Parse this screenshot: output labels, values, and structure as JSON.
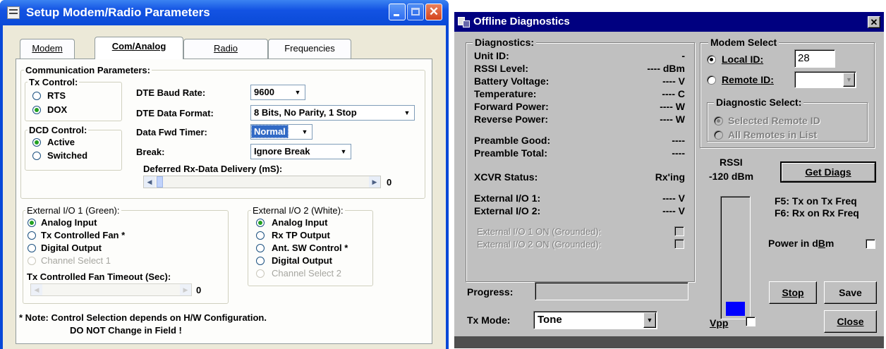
{
  "setup_window": {
    "title": "Setup Modem/Radio Parameters",
    "tabs": [
      "Modem",
      "Com/Analog",
      "Radio",
      "Frequencies"
    ],
    "comm_group": "Communication Parameters:",
    "tx_control": {
      "label": "Tx Control:",
      "options": [
        "RTS",
        "DOX"
      ],
      "selected": "DOX"
    },
    "dcd_control": {
      "label": "DCD Control:",
      "options": [
        "Active",
        "Switched"
      ],
      "selected": "Active"
    },
    "fields": {
      "baud_label": "DTE Baud Rate:",
      "baud_value": "9600",
      "format_label": "DTE Data Format:",
      "format_value": "8 Bits, No Parity, 1 Stop",
      "timer_label": "Data Fwd Timer:",
      "timer_value": "Normal",
      "break_label": "Break:",
      "break_value": "Ignore Break",
      "deferred_label": "Deferred Rx-Data Delivery (mS):",
      "deferred_value": "0"
    },
    "ext_io_1": {
      "label": "External I/O 1 (Green):",
      "options": [
        "Analog Input",
        "Tx Controlled Fan *",
        "Digital Output",
        "Channel Select 1"
      ],
      "selected": "Analog Input",
      "fan_timeout_label": "Tx Controlled Fan Timeout (Sec):",
      "fan_timeout_value": "0"
    },
    "ext_io_2": {
      "label": "External I/O 2 (White):",
      "options": [
        "Analog Input",
        "Rx TP Output",
        "Ant. SW Control *",
        "Digital Output",
        "Channel Select 2"
      ],
      "selected": "Analog Input"
    },
    "note_line1": "* Note:  Control Selection depends on H/W Configuration.",
    "note_line2": "DO NOT Change in Field !"
  },
  "diag_window": {
    "title": "Offline Diagnostics",
    "diag_group": "Diagnostics:",
    "rows": [
      {
        "label": "Unit ID:",
        "value": "-"
      },
      {
        "label": "RSSI Level:",
        "value": "---- dBm"
      },
      {
        "label": "Battery Voltage:",
        "value": "---- V"
      },
      {
        "label": "Temperature:",
        "value": "---- C"
      },
      {
        "label": "Forward Power:",
        "value": "---- W"
      },
      {
        "label": "Reverse Power:",
        "value": "---- W"
      },
      {
        "label": "Preamble Good:",
        "value": "----"
      },
      {
        "label": "Preamble Total:",
        "value": "----"
      },
      {
        "label": "XCVR Status:",
        "value": "Rx'ing"
      },
      {
        "label": "External I/O 1:",
        "value": "---- V"
      },
      {
        "label": "External I/O 2:",
        "value": "---- V"
      }
    ],
    "ext_on_1": "External I/O 1 ON (Grounded):",
    "ext_on_2": "External I/O 2 ON (Grounded):",
    "modem_select": "Modem Select",
    "local_id_label": "Local ID:",
    "local_id_value": "28",
    "remote_id_label": "Remote ID:",
    "diag_select": "Diagnostic Select:",
    "selected_remote": "Selected Remote ID",
    "all_remotes": "All Remotes in List",
    "rssi_label": "RSSI",
    "rssi_value": "-120 dBm",
    "rssi_level": 0.12,
    "get_diags": "Get Diags",
    "f5": "F5: Tx on Tx Freq",
    "f6": "F6: Rx on Rx Freq",
    "power_dbm": "Power in dBm",
    "progress_label": "Progress:",
    "stop": "Stop",
    "save": "Save",
    "tx_mode_label": "Tx Mode:",
    "tx_mode_value": "Tone",
    "vpp": "Vpp",
    "close": "Close"
  }
}
